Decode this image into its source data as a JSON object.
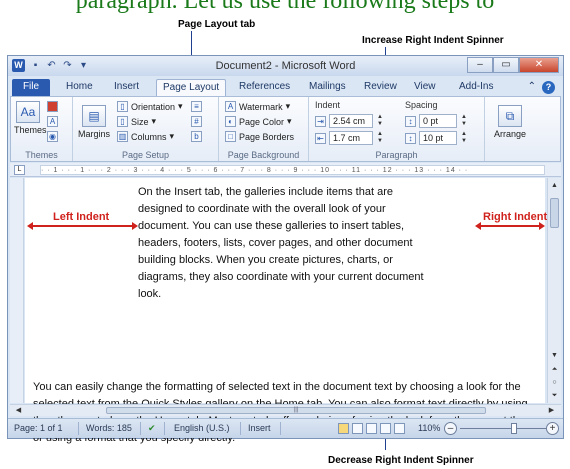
{
  "header": {
    "top_text": "paragraph. Let us use the following steps to"
  },
  "callouts": {
    "page_layout_tab": "Page Layout tab",
    "increase_spinner": "Increase Right Indent Spinner",
    "decrease_spinner": "Decrease Right Indent Spinner",
    "left_indent": "Left Indent",
    "right_indent": "Right Indent"
  },
  "window": {
    "title": "Document2 - Microsoft Word",
    "app_icon_letter": "W",
    "minimize": "–",
    "maximize": "▭",
    "close": "✕"
  },
  "tabs": {
    "file": "File",
    "items": [
      "Home",
      "Insert",
      "Page Layout",
      "References",
      "Mailings",
      "Review",
      "View",
      "Add-Ins"
    ],
    "active": "Page Layout",
    "help": "?"
  },
  "ribbon": {
    "themes": {
      "button": "Themes",
      "group_label": "Themes"
    },
    "page_setup": {
      "margins": "Margins",
      "orientation": "Orientation",
      "size": "Size",
      "columns": "Columns",
      "group_label": "Page Setup"
    },
    "page_background": {
      "watermark": "Watermark",
      "page_color": "Page Color",
      "page_borders": "Page Borders",
      "group_label": "Page Background"
    },
    "paragraph": {
      "indent_title": "Indent",
      "indent_left_value": "2.54 cm",
      "indent_right_value": "1.7 cm",
      "spacing_title": "Spacing",
      "spacing_before_value": "0 pt",
      "spacing_after_value": "10 pt",
      "group_label": "Paragraph"
    },
    "arrange": {
      "button": "Arrange"
    }
  },
  "ruler": {
    "marks": "· · 1 · · · 1 · · · 2 · · · 3 · · · 4 · · · 5 · · · 6 · · · 7 · · · 8 · · · 9 · · · 10 · · · 11 · · · 12 · · · 13 · · · 14 · ·",
    "tab_selector": "L"
  },
  "document": {
    "paragraph1": "On the Insert tab, the galleries include items that are designed to coordinate with the overall look of your document. You can use these galleries to insert tables, headers, footers, lists, cover pages, and other document building blocks. When you create pictures, charts, or diagrams, they also coordinate with your current document look.",
    "paragraph2": "You can easily change the formatting of selected text in the document text by choosing a look for the selected text from the Quick Styles gallery on the Home tab. You can also format text directly by using the other controls on the Home tab. Most controls offer a choice of using the look from the current theme or using a format that you specify directly."
  },
  "status": {
    "page": "Page: 1 of 1",
    "words": "Words: 185",
    "language": "English (U.S.)",
    "mode": "Insert",
    "zoom": "110%",
    "zoom_out": "–",
    "zoom_in": "+"
  },
  "colors": {
    "accent": "#2a5ab0",
    "indent_annotation": "#d0221c",
    "callout_line": "#1f3f8f"
  }
}
